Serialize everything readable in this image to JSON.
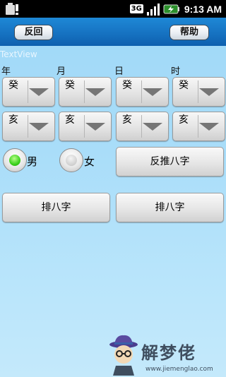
{
  "status_bar": {
    "network": "3G",
    "time": "9:13 AM",
    "icons": [
      "sim-alert-icon",
      "signal-icon",
      "battery-icon"
    ]
  },
  "title_bar": {
    "back_label": "反回",
    "help_label": "帮助"
  },
  "textview_label": "TextView",
  "columns": {
    "year": "年",
    "month": "月",
    "day": "日",
    "hour": "时"
  },
  "stem_row": [
    "癸",
    "癸",
    "癸",
    "癸"
  ],
  "branch_row": [
    "亥",
    "亥",
    "亥",
    "亥"
  ],
  "gender": {
    "male_label": "男",
    "female_label": "女",
    "selected": "男"
  },
  "reverse_button": "反推八字",
  "paibazi_buttons": [
    "排八字",
    "排八字"
  ],
  "watermark": {
    "title": "解梦佬",
    "url": "www.jiemenglao.com"
  },
  "colors": {
    "title_bar": "#1775c4",
    "background": "#a9ddf9",
    "radio_selected": "#3bd11c"
  }
}
